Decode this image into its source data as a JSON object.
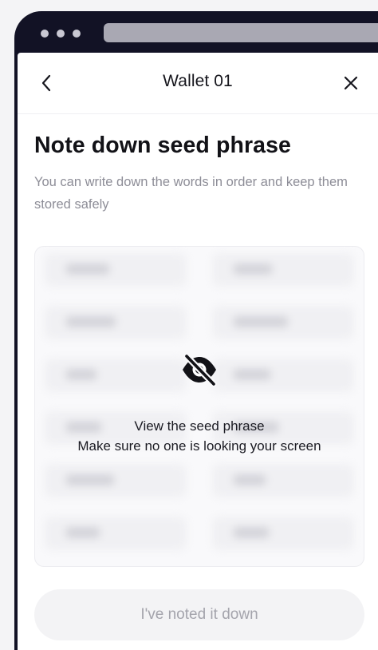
{
  "header": {
    "title": "Wallet 01",
    "back_icon": "chevron-left-icon",
    "close_icon": "close-icon"
  },
  "content": {
    "heading": "Note down seed phrase",
    "subtitle": "You can write down the words in order and keep them stored safely"
  },
  "seed_panel": {
    "hidden_icon": "eye-off-icon",
    "line1": "View the seed phrase",
    "line2": "Make sure no one is looking your screen"
  },
  "actions": {
    "confirm_label": "I've noted it down"
  },
  "colors": {
    "device_frame": "#121225",
    "text_primary": "#121217",
    "text_secondary": "#8d8d97",
    "button_disabled_bg": "#f3f3f5",
    "button_disabled_text": "#a4a4ac"
  }
}
